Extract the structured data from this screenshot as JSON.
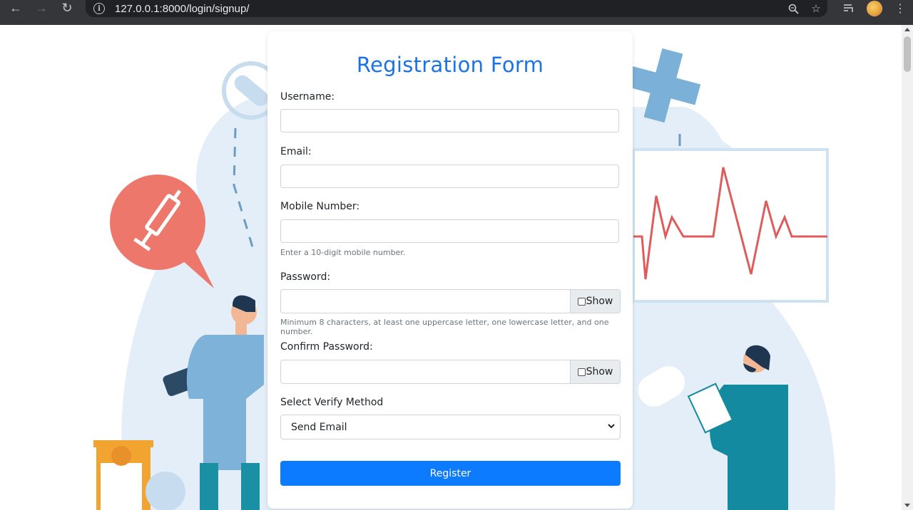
{
  "browser": {
    "url": "127.0.0.1:8000/login/signup/",
    "back_icon": "arrow-left-icon",
    "forward_icon": "arrow-right-icon",
    "reload_icon": "reload-icon"
  },
  "form": {
    "title": "Registration Form",
    "username_label": "Username:",
    "username_value": "",
    "email_label": "Email:",
    "email_value": "",
    "mobile_label": "Mobile Number:",
    "mobile_value": "",
    "mobile_hint": "Enter a 10-digit mobile number.",
    "password_label": "Password:",
    "password_value": "",
    "password_show": "Show",
    "password_hint": "Minimum 8 characters, at least one uppercase letter, one lowercase letter, and one number.",
    "confirm_label": "Confirm Password:",
    "confirm_value": "",
    "confirm_show": "Show",
    "verify_label": "Select Verify Method",
    "verify_selected": "Send Email",
    "register_label": "Register"
  },
  "colors": {
    "title": "#1a73e8",
    "button": "#0d7bff",
    "chrome": "#35363a"
  }
}
